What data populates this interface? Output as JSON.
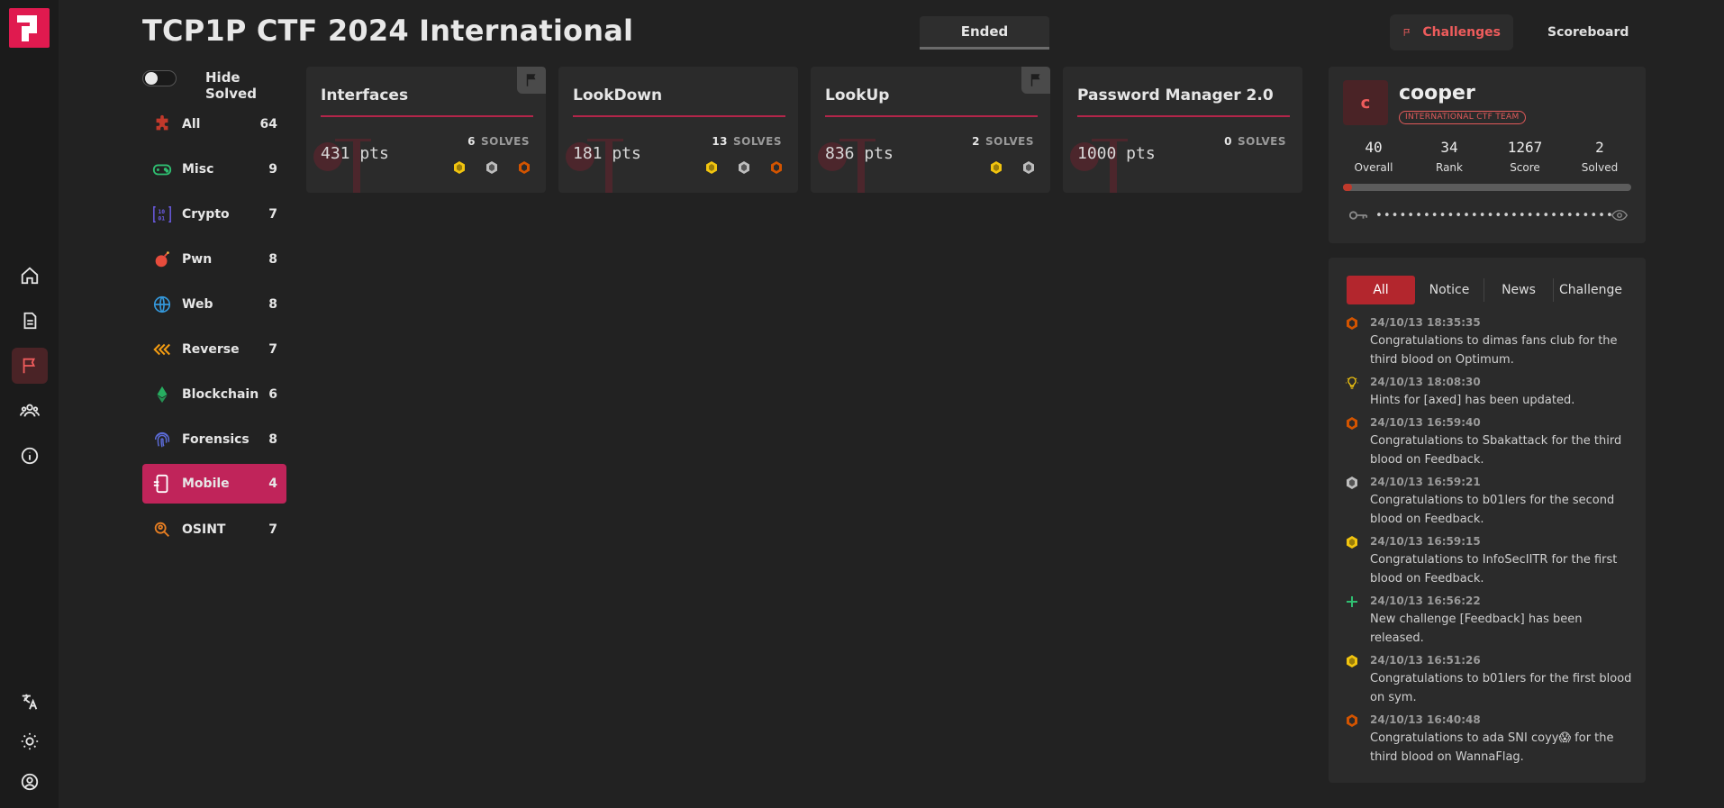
{
  "header": {
    "title": "TCP1P CTF 2024 International",
    "status": "Ended",
    "nav": {
      "challenges": "Challenges",
      "scoreboard": "Scoreboard"
    }
  },
  "filter": {
    "hide_solved_label": "Hide Solved",
    "hide_solved": false
  },
  "categories": [
    {
      "name": "All",
      "count": "64",
      "icon": "puzzle-icon",
      "color": "#c0392b"
    },
    {
      "name": "Misc",
      "count": "9",
      "icon": "gamepad-icon",
      "color": "#2fbf71"
    },
    {
      "name": "Crypto",
      "count": "7",
      "icon": "binary-icon",
      "color": "#6c5ce7"
    },
    {
      "name": "Pwn",
      "count": "8",
      "icon": "bomb-icon",
      "color": "#e74c3c"
    },
    {
      "name": "Web",
      "count": "8",
      "icon": "globe-icon",
      "color": "#3498db"
    },
    {
      "name": "Reverse",
      "count": "7",
      "icon": "rewind-icon",
      "color": "#f39c12"
    },
    {
      "name": "Blockchain",
      "count": "6",
      "icon": "ethereum-icon",
      "color": "#27ae60"
    },
    {
      "name": "Forensics",
      "count": "8",
      "icon": "fingerprint-icon",
      "color": "#5b6bd6"
    },
    {
      "name": "Mobile",
      "count": "4",
      "icon": "mobile-icon",
      "color": "#ffffff",
      "active": true
    },
    {
      "name": "OSINT",
      "count": "7",
      "icon": "search-person-icon",
      "color": "#e67e22"
    }
  ],
  "challenges": [
    {
      "name": "Interfaces",
      "points": "431 pts",
      "solves": "6",
      "solves_label": "SOLVES",
      "solved": true,
      "bloods": [
        "first-blood-icon",
        "second-blood-icon",
        "third-blood-icon"
      ]
    },
    {
      "name": "LookDown",
      "points": "181 pts",
      "solves": "13",
      "solves_label": "SOLVES",
      "solved": false,
      "bloods": [
        "first-blood-icon",
        "second-blood-icon",
        "third-blood-icon"
      ]
    },
    {
      "name": "LookUp",
      "points": "836 pts",
      "solves": "2",
      "solves_label": "SOLVES",
      "solved": true,
      "bloods": [
        "first-blood-icon",
        "second-blood-icon"
      ]
    },
    {
      "name": "Password Manager 2.0",
      "points": "1000 pts",
      "solves": "0",
      "solves_label": "SOLVES",
      "solved": false,
      "bloods": []
    }
  ],
  "profile": {
    "avatar_letter": "c",
    "username": "cooper",
    "team": "INTERNATIONAL CTF TEAM",
    "stats": [
      {
        "value": "40",
        "label": "Overall"
      },
      {
        "value": "34",
        "label": "Rank"
      },
      {
        "value": "1267",
        "label": "Score"
      },
      {
        "value": "2",
        "label": "Solved"
      }
    ],
    "progress": 0.03,
    "masked_token": "••••••••••••••••••••••••••••••••"
  },
  "notices": {
    "tabs": [
      "All",
      "Notice",
      "News",
      "Challenge"
    ],
    "active_tab": "All",
    "items": [
      {
        "icon": "third-blood-icon",
        "time": "24/10/13 18:35:35",
        "text": "Congratulations to dimas fans club for the third blood on Optimum."
      },
      {
        "icon": "lightbulb-icon",
        "time": "24/10/13 18:08:30",
        "text": "Hints for [axed] has been updated."
      },
      {
        "icon": "third-blood-icon",
        "time": "24/10/13 16:59:40",
        "text": "Congratulations to Sbakattack  for the third blood on Feedback."
      },
      {
        "icon": "second-blood-icon",
        "time": "24/10/13 16:59:21",
        "text": "Congratulations to b01lers for the second blood on Feedback."
      },
      {
        "icon": "first-blood-icon",
        "time": "24/10/13 16:59:15",
        "text": "Congratulations to InfoSecIITR for the first blood on Feedback."
      },
      {
        "icon": "plus-icon",
        "time": "24/10/13 16:56:22",
        "text": "New challenge [Feedback] has been released."
      },
      {
        "icon": "first-blood-icon",
        "time": "24/10/13 16:51:26",
        "text": "Congratulations to b01lers for the first blood on sym."
      },
      {
        "icon": "third-blood-icon",
        "time": "24/10/13 16:40:48",
        "text": "Congratulations to ada SNI coyy😱 for the third blood on WannaFlag."
      }
    ]
  }
}
